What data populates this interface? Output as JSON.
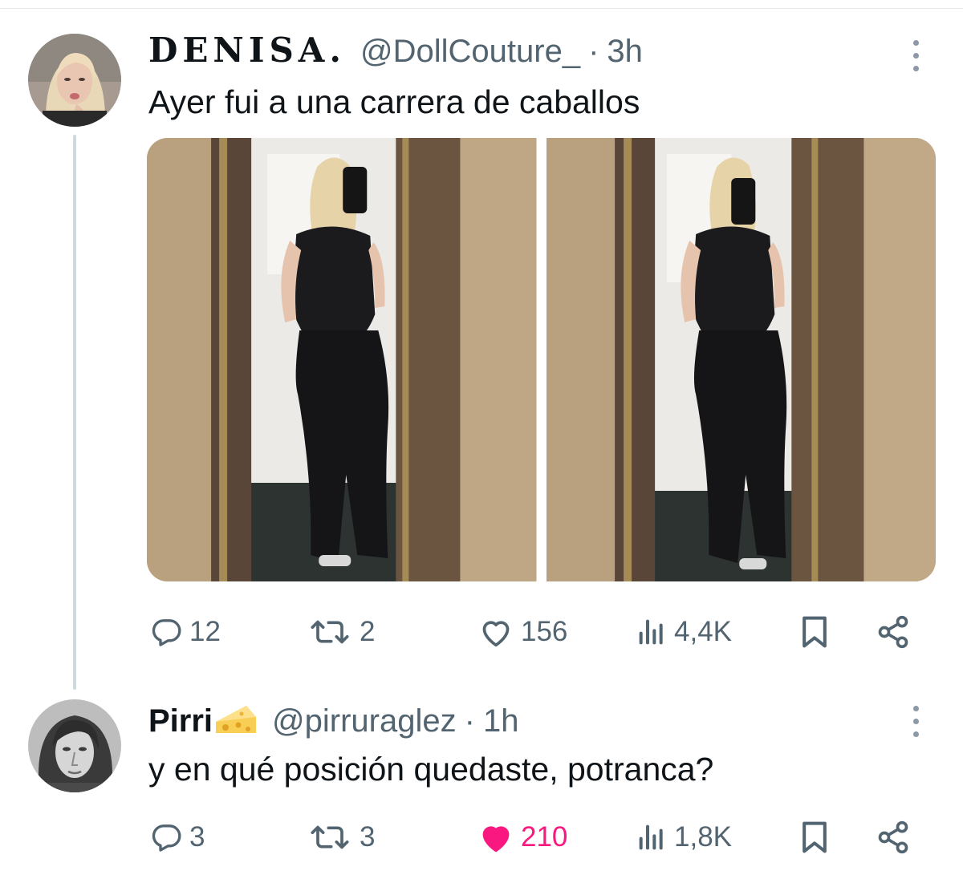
{
  "tweets": [
    {
      "display_name": "DENISA.",
      "handle": "@DollCouture_",
      "separator": "·",
      "time": "3h",
      "text": "Ayer fui a una carrera de caballos",
      "avatar_icon": "profile-photo-woman",
      "media": [
        "mirror-selfie-photo-1",
        "mirror-selfie-photo-2"
      ],
      "stats": {
        "replies": "12",
        "reposts": "2",
        "likes": "156",
        "views": "4,4K"
      },
      "liked": false
    },
    {
      "display_name": "Pirri",
      "name_emoji": "cheese-emoji",
      "handle": "@pirruraglez",
      "separator": "·",
      "time": "1h",
      "text": "y en qué posición quedaste, potranca?",
      "avatar_icon": "profile-photo-man",
      "stats": {
        "replies": "3",
        "reposts": "3",
        "likes": "210",
        "views": "1,8K"
      },
      "liked": true
    }
  ],
  "colors": {
    "text": "#0f1419",
    "secondary": "#536471",
    "like_active": "#f91880",
    "thread_line": "#cfd9de"
  }
}
